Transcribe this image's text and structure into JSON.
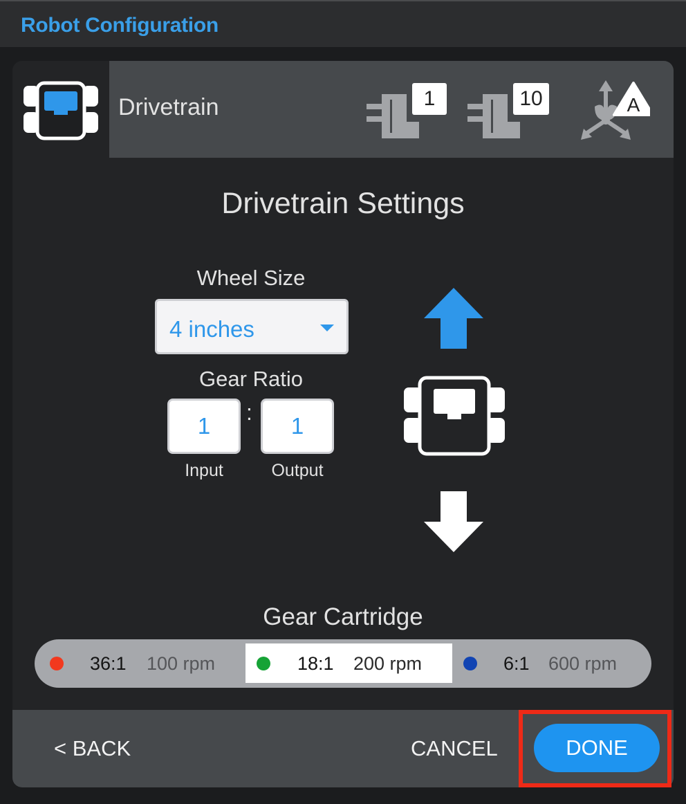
{
  "app": {
    "title": "Robot Configuration"
  },
  "header": {
    "title": "Drivetrain",
    "icons": [
      {
        "name": "motor-port-icon",
        "badge": "1"
      },
      {
        "name": "motor-port-icon",
        "badge": "10"
      },
      {
        "name": "gyro-sensor-icon",
        "badge": "A"
      }
    ]
  },
  "settings": {
    "title": "Drivetrain Settings",
    "wheel_size": {
      "label": "Wheel Size",
      "value": "4 inches"
    },
    "gear_ratio": {
      "label": "Gear Ratio",
      "input": "1",
      "output": "1",
      "separator": ":",
      "input_label": "Input",
      "output_label": "Output"
    }
  },
  "cartridge": {
    "title": "Gear Cartridge",
    "options": [
      {
        "ratio": "36:1",
        "rpm": "100 rpm",
        "color": "#f2391e",
        "selected": false
      },
      {
        "ratio": "18:1",
        "rpm": "200 rpm",
        "color": "#16a336",
        "selected": true
      },
      {
        "ratio": "6:1",
        "rpm": "600 rpm",
        "color": "#1144b3",
        "selected": false
      }
    ]
  },
  "colors": {
    "accent": "#1e94f0",
    "highlight": "#ee2a17"
  },
  "footer": {
    "back": "< BACK",
    "cancel": "CANCEL",
    "done": "DONE"
  }
}
